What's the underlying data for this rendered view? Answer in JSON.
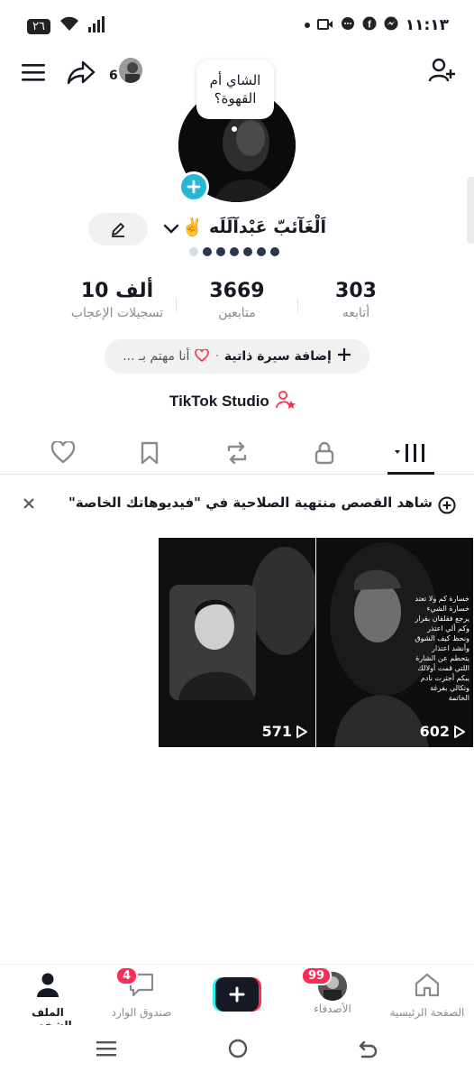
{
  "status": {
    "time": "١١:١٣",
    "battery": "٢٦"
  },
  "profile": {
    "follow_count_badge": "6",
    "thought_bubble": "الشاي أم القهوة؟",
    "username": "اَلْغَآئبّ عَبْدآلَلَه ✌️",
    "stats": [
      {
        "value": "303",
        "label": "أتابعه"
      },
      {
        "value": "3669",
        "label": "متابعين"
      },
      {
        "value": "10 ألف",
        "label": "تسجيلات الإعجاب"
      }
    ],
    "bio_add": "إضافة سيرة ذاتية",
    "bio_dot": "·",
    "interest": "أنا مهتم بـ ...",
    "studio": "TikTok Studio"
  },
  "banner": {
    "text": "شاهد القصص منتهية الصلاحية في \"فيديوهاتك الخاصة\""
  },
  "videos": [
    {
      "views": "602"
    },
    {
      "views": "571"
    }
  ],
  "poster_text": "خسارة كم ولا تعتد خسارة الشيء يرجع فقلقان بقرار وكم ألي اعتذر ونحظ كيف الشوق وأنشد اعتذار يتحطم عن الشارة اللتي قمت أولالك يبكم أجثرت نادم وتكالي بفرغة الخاتمة",
  "nav": {
    "home": "الصفحة الرئيسية",
    "friends": "الأصدقاء",
    "friends_badge": "99",
    "inbox": "صندوق الوارد",
    "inbox_badge": "4",
    "profile": "الملف الشخصي"
  },
  "colors": {
    "accent": "#fe2c55",
    "cyan": "#25b7d3",
    "text": "#161823",
    "muted": "#8a8b91"
  }
}
